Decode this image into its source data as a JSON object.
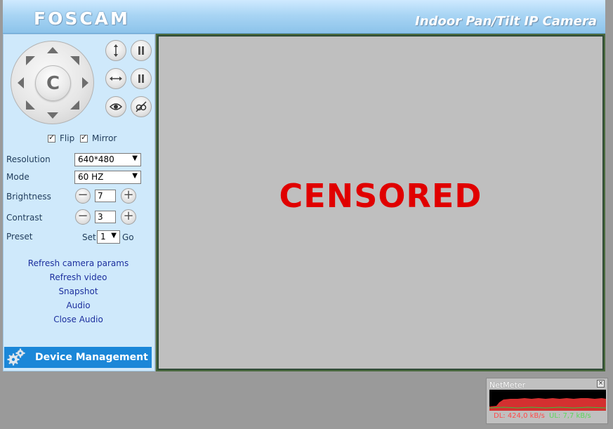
{
  "header": {
    "logo": "FOSCAM",
    "title": "Indoor Pan/Tilt IP Camera"
  },
  "ptz": {
    "center_label": "C",
    "icons": [
      "up-arrow-icon",
      "up-right-arrow-icon",
      "right-arrow-icon",
      "down-right-arrow-icon",
      "down-arrow-icon",
      "down-left-arrow-icon",
      "left-arrow-icon",
      "up-left-arrow-icon"
    ]
  },
  "controls": {
    "flip_label": "Flip",
    "flip_checked": true,
    "mirror_label": "Mirror",
    "mirror_checked": true,
    "resolution_label": "Resolution",
    "resolution_value": "640*480",
    "mode_label": "Mode",
    "mode_value": "60 HZ",
    "brightness_label": "Brightness",
    "brightness_value": "7",
    "contrast_label": "Contrast",
    "contrast_value": "3",
    "preset_label": "Preset",
    "preset_set": "Set",
    "preset_value": "1",
    "preset_go": "Go",
    "minus": "−",
    "plus": "+"
  },
  "links": {
    "refresh_params": "Refresh camera params",
    "refresh_video": "Refresh video",
    "snapshot": "Snapshot",
    "audio": "Audio",
    "close_audio": "Close Audio"
  },
  "device_management": "Device Management",
  "video": {
    "overlay_text": "CENSORED"
  },
  "netmeter": {
    "title": "NetMeter",
    "close": "×",
    "dl": "DL: 424,0 kB/s",
    "ul": "UL: 7,7 kB/s"
  },
  "colors": {
    "accent": "#1b87d8",
    "sidebar_bg": "#cfe9fb",
    "censored": "#e00000"
  }
}
